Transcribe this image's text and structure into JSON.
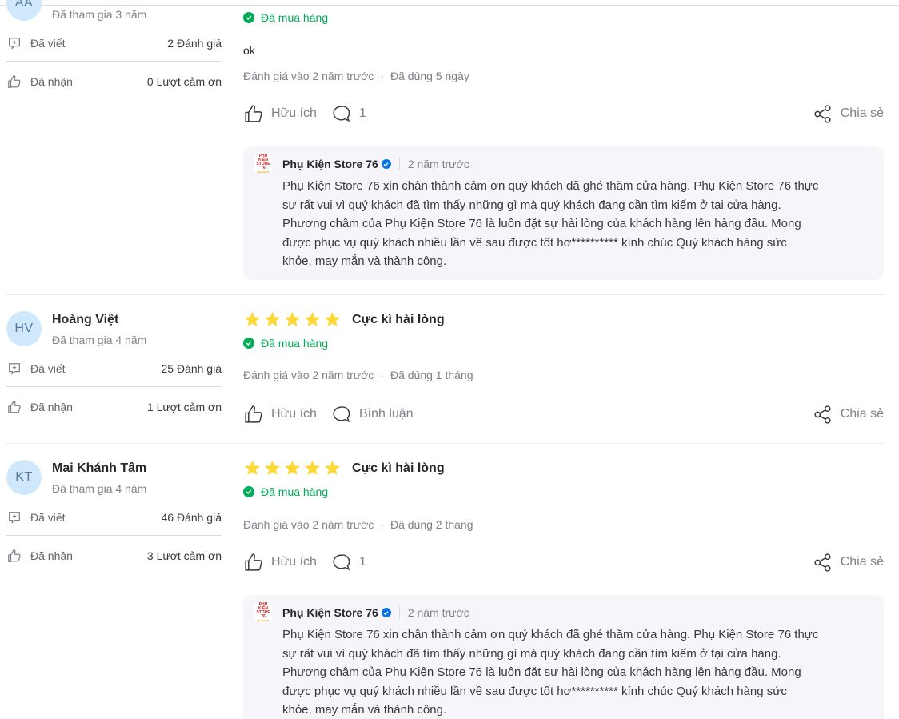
{
  "labels": {
    "joined_prefix": "Đã tham gia",
    "written": "Đã viết",
    "received": "Đã nhận",
    "bought": "Đã mua hàng",
    "reviewed_prefix": "Đánh giá vào",
    "used_prefix": "Đã dùng",
    "helpful": "Hữu ích",
    "comment": "Bình luận",
    "share": "Chia sẻ",
    "dot": "·"
  },
  "colors": {
    "star": "#fdd836",
    "bought": "#00ab56",
    "verified": "#0b74e5",
    "avatar_bg": "#cfe8fc"
  },
  "reviews": [
    {
      "initials": "AA",
      "joined": "Đã tham gia 3 năm",
      "written_count": "2 Đánh giá",
      "received_count": "0 Lượt cảm ơn",
      "bought": "Đã mua hàng",
      "content": "ok",
      "reviewed": "Đánh giá vào 2 năm trước",
      "used": "Đã dùng 5 ngày",
      "helpful": "Hữu ích",
      "comment": "1",
      "share": "Chia sẻ",
      "reply": {
        "shop_logo": "PHỤ KIỆN STORE 76",
        "shop_logo_sub": "phukien76",
        "shop_name": "Phụ Kiện Store 76",
        "time": "2 năm trước",
        "lines": [
          "Phụ Kiện Store 76 xin chân thành cảm ơn quý khách đã ghé thăm cửa hàng. Phụ Kiện Store 76 thực",
          "sự rất vui vì quý khách đã tìm thấy những gì mà quý khách đang cần tìm kiếm ở tại cửa hàng.",
          "Phương châm của Phụ Kiện Store 76 là luôn đặt sự hài lòng của khách hàng lên hàng đầu. Mong",
          "được phục vụ quý khách nhiều lần về sau được tốt hơ********** kính chúc Quý khách hàng sức",
          "khỏe, may mắn và thành công."
        ]
      }
    },
    {
      "initials": "HV",
      "name": "Hoàng Việt",
      "joined": "Đã tham gia 4 năm",
      "written_count": "25 Đánh giá",
      "received_count": "1 Lượt cảm ơn",
      "rating": 5,
      "title": "Cực kì hài lòng",
      "bought": "Đã mua hàng",
      "reviewed": "Đánh giá vào 2 năm trước",
      "used": "Đã dùng 1 tháng",
      "helpful": "Hữu ích",
      "comment": "Bình luận",
      "share": "Chia sẻ"
    },
    {
      "initials": "KT",
      "name": "Mai Khánh Tâm",
      "joined": "Đã tham gia 4 năm",
      "written_count": "46 Đánh giá",
      "received_count": "3 Lượt cảm ơn",
      "rating": 5,
      "title": "Cực kì hài lòng",
      "bought": "Đã mua hàng",
      "reviewed": "Đánh giá vào 2 năm trước",
      "used": "Đã dùng 2 tháng",
      "helpful": "Hữu ích",
      "comment": "1",
      "share": "Chia sẻ",
      "reply": {
        "shop_logo": "PHỤ KIỆN STORE 76",
        "shop_logo_sub": "phukien76",
        "shop_name": "Phụ Kiện Store 76",
        "time": "2 năm trước",
        "lines": [
          "Phụ Kiện Store 76 xin chân thành cảm ơn quý khách đã ghé thăm cửa hàng. Phụ Kiện Store 76 thực",
          "sự rất vui vì quý khách đã tìm thấy những gì mà quý khách đang cần tìm kiếm ở tại cửa hàng.",
          "Phương châm của Phụ Kiện Store 76 là luôn đặt sự hài lòng của khách hàng lên hàng đầu. Mong",
          "được phục vụ quý khách nhiều lần về sau được tốt hơ********** kính chúc Quý khách hàng sức",
          "khỏe, may mắn và thành công."
        ]
      }
    }
  ]
}
